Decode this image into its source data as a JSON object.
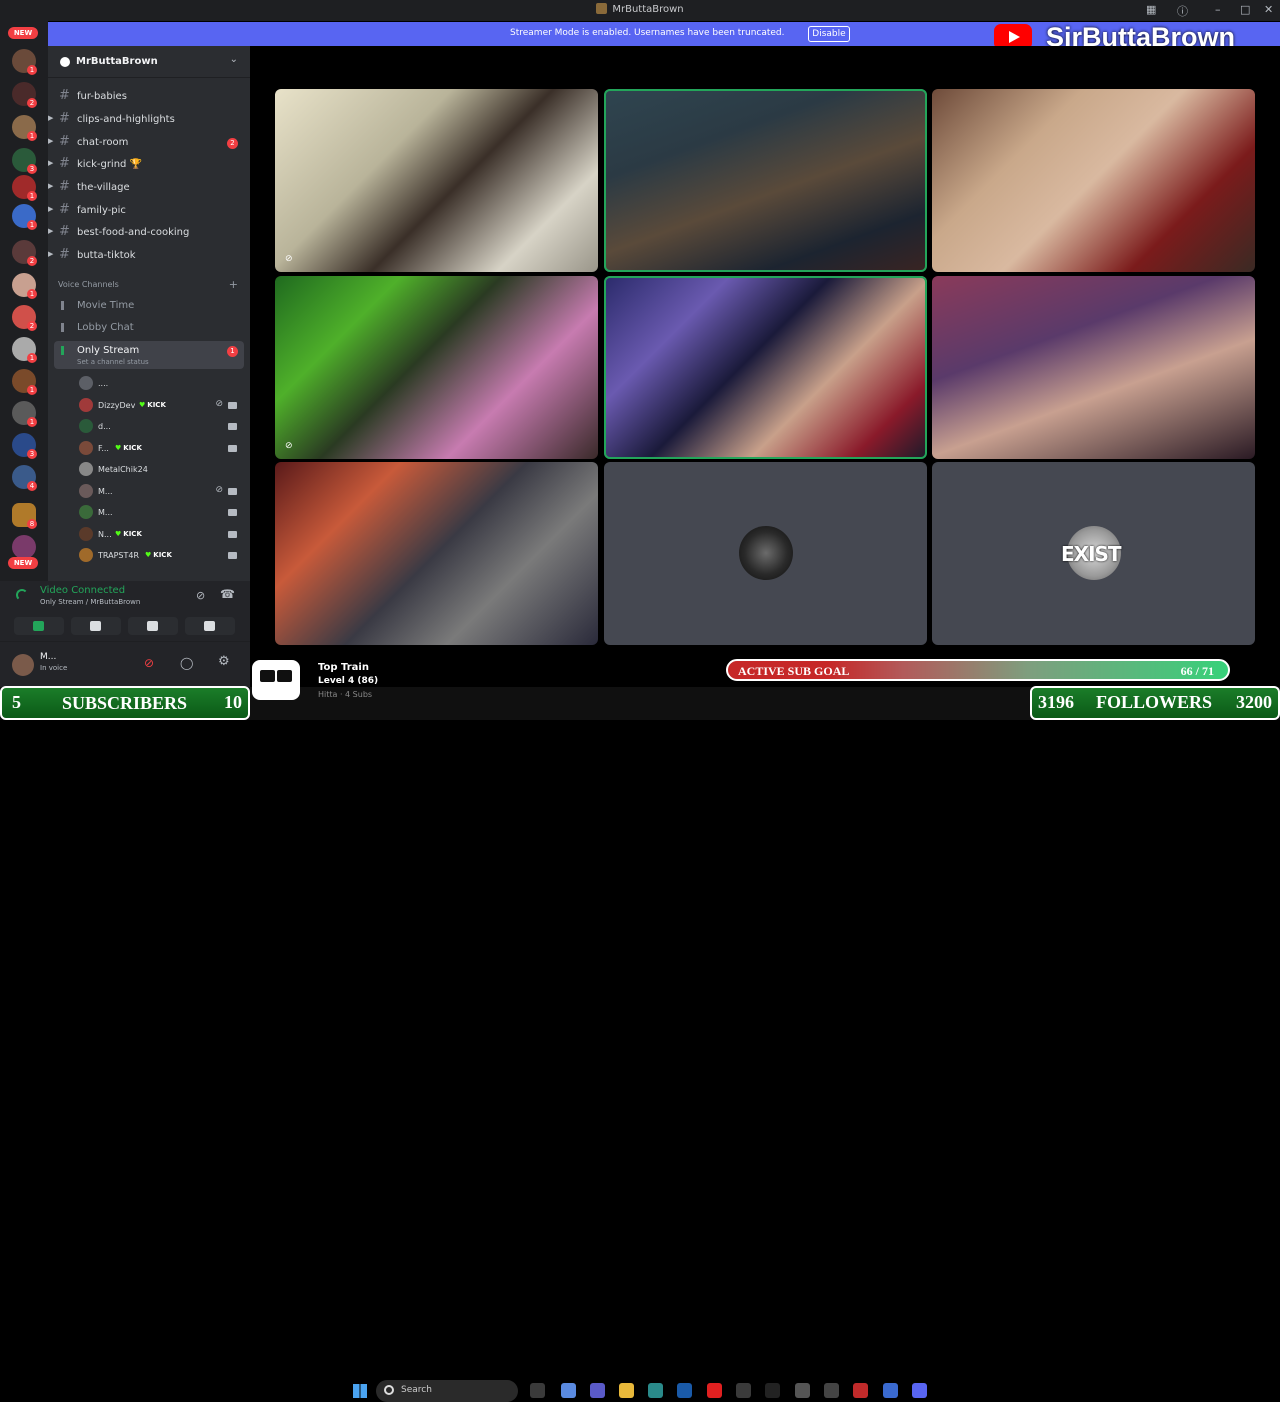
{
  "titlebar": {
    "title": "MrButtaBrown"
  },
  "banner": {
    "message": "Streamer Mode is enabled. Usernames have been truncated.",
    "button": "Disable"
  },
  "channel_overlay_name": "SirButtaBrown",
  "servers": {
    "new_top": "NEW",
    "new_bottom": "NEW",
    "badges": [
      "1",
      "2",
      "1",
      "3",
      "1",
      "1",
      "2",
      "1",
      "2",
      "1",
      "1",
      "1",
      "3",
      "4",
      "8"
    ]
  },
  "guild": {
    "name": "MrButtaBrown"
  },
  "text_channels": [
    {
      "label": "fur-babies",
      "badge": ""
    },
    {
      "label": "clips-and-highlights",
      "badge": ""
    },
    {
      "label": "chat-room",
      "badge": "2"
    },
    {
      "label": "kick-grind 🏆",
      "badge": ""
    },
    {
      "label": "the-village",
      "badge": ""
    },
    {
      "label": "family-pic",
      "badge": ""
    },
    {
      "label": "best-food-and-cooking",
      "badge": ""
    },
    {
      "label": "butta-tiktok",
      "badge": ""
    }
  ],
  "voice_header": "Voice Channels",
  "voice_channels": [
    {
      "label": "Movie Time"
    },
    {
      "label": "Lobby Chat"
    },
    {
      "label": "Only Stream",
      "badge": "1",
      "status": "Set a channel status"
    }
  ],
  "voice_users": [
    {
      "name": "....",
      "kick": ""
    },
    {
      "name": "DizzyDev",
      "kick": "KICK"
    },
    {
      "name": "d...",
      "kick": ""
    },
    {
      "name": "F...",
      "kick": "KICK"
    },
    {
      "name": "MetalChik24",
      "kick": ""
    },
    {
      "name": "M...",
      "kick": ""
    },
    {
      "name": "M...",
      "kick": ""
    },
    {
      "name": "N...",
      "kick": "KICK"
    },
    {
      "name": "TRAPST4R",
      "kick": "KICK"
    }
  ],
  "voice_panel": {
    "status": "Video Connected",
    "sub": "Only Stream / MrButtaBrown"
  },
  "user_panel": {
    "name": "M...",
    "sub": "In voice"
  },
  "tiles": [
    {
      "name": "tile-1",
      "bg": "linear-gradient(135deg,#e8e2c9 0,#b9b49a 35%,#3a2f28 55%,#d7d3c6 80%,#9a968a 100%)",
      "speaking": false
    },
    {
      "name": "tile-2",
      "bg": "linear-gradient(160deg,#2f4550 0,#2b3a44 30%,#5a4a3a 55%,#1c2430 80%,#3a2422 100%)",
      "speaking": true
    },
    {
      "name": "tile-3",
      "bg": "linear-gradient(135deg,#6e4b3a 0,#c9a88a 30%,#d9b9a0 50%,#7b1b1b 75%,#3a2a24 100%)",
      "speaking": false
    },
    {
      "name": "tile-4",
      "bg": "linear-gradient(135deg,#1f6a1f 0,#4fb02a 25%,#2a3a22 45%,#c77bb0 70%,#3a2a2a 100%)",
      "speaking": false
    },
    {
      "name": "tile-5",
      "bg": "linear-gradient(135deg,#2a2a6a 0,#6a5ab0 25%,#1a1a3a 45%,#c8a08a 65%,#8a1a2a 85%,#1a1a2a 100%)",
      "speaking": true
    },
    {
      "name": "tile-6",
      "bg": "linear-gradient(160deg,#8a3a5a 0,#5a3a6a 35%,#c8a090 60%,#2a1a24 100%)",
      "speaking": false
    },
    {
      "name": "tile-7",
      "bg": "linear-gradient(135deg,#5a1a1a 0,#c85a3a 25%,#3a3a44 50%,#7a7a7a 70%,#2a2a3a 100%)",
      "speaking": false
    },
    {
      "name": "tile-8-gorilla",
      "placeholder": true,
      "logo": "gorilla",
      "text": ""
    },
    {
      "name": "tile-9-exist",
      "placeholder": true,
      "logo": "exist",
      "text": "EXIST"
    }
  ],
  "subs": {
    "current": "5",
    "label": "SUBSCRIBERS",
    "target": "10"
  },
  "top_train": {
    "title": "Top Train",
    "level": "Level 4 (86)",
    "sub": "Hitta · 4 Subs"
  },
  "sub_goal": {
    "label": "ACTIVE SUB GOAL",
    "value": "66 / 71",
    "current": 66,
    "target": 71
  },
  "followers": {
    "current": "3196",
    "label": "FOLLOWERS",
    "target": "3200"
  },
  "taskbar": {
    "search_placeholder": "Search"
  },
  "colors": {
    "accent": "#5865f2",
    "green": "#23a55a",
    "red": "#f23f43",
    "kick": "#53fc18"
  }
}
